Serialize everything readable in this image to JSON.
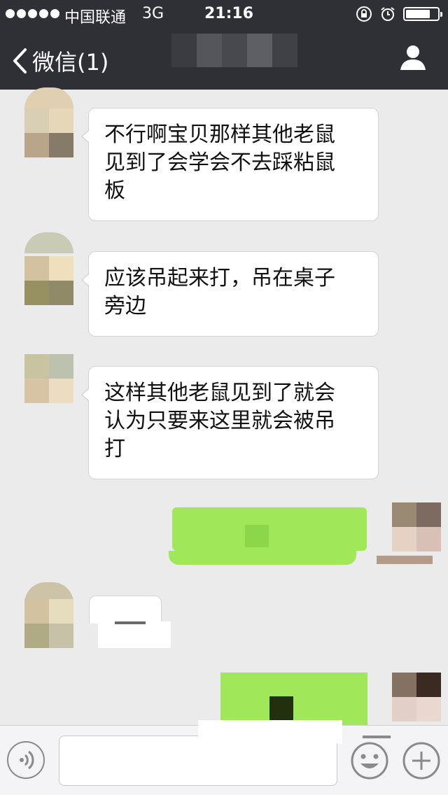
{
  "status_bar": {
    "carrier": "中国联通",
    "network": "3G",
    "time": "21:16",
    "battery_level": 0.8
  },
  "nav": {
    "back_label": "微信(1)",
    "back_icon": "chevron-left-icon",
    "profile_icon": "person-icon"
  },
  "messages": [
    {
      "side": "left",
      "text": "不行啊宝贝那样其他老鼠\n见到了会学会不去踩粘鼠\n板"
    },
    {
      "side": "left",
      "text": "应该吊起来打，吊在桌子\n旁边"
    },
    {
      "side": "left",
      "text": "这样其他老鼠见到了就会\n认为只要来这里就会被吊\n打"
    }
  ],
  "colors": {
    "nav_background": "#2e3035",
    "chat_background": "#ebebeb",
    "sent_bubble": "#a0e75a",
    "received_bubble": "#ffffff"
  },
  "input_bar": {
    "voice_icon": "voice-icon",
    "emoji_icon": "emoji-icon",
    "plus_icon": "plus-icon",
    "placeholder": ""
  }
}
